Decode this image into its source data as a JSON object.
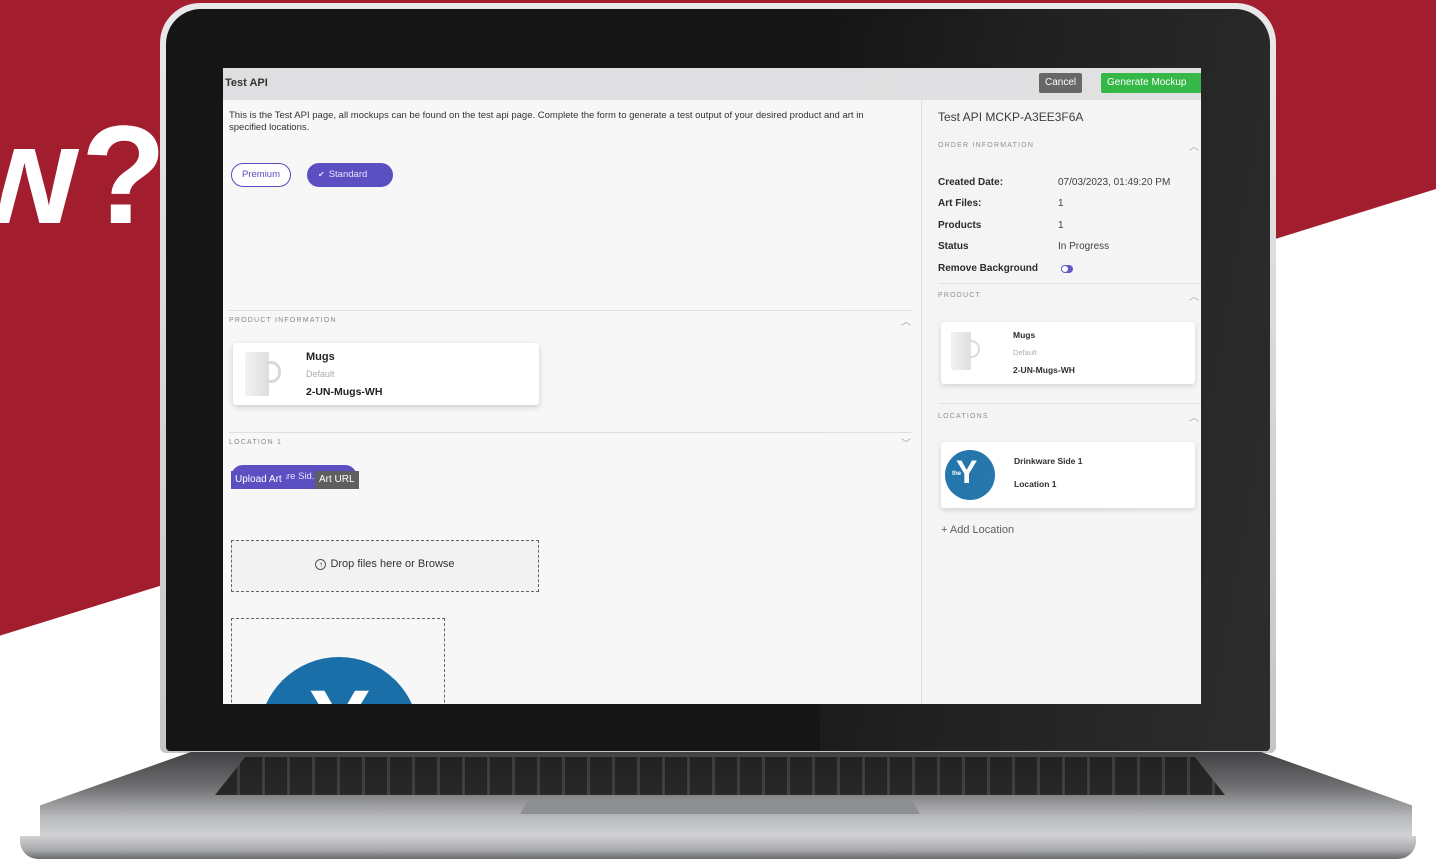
{
  "background": {
    "headline": "w?",
    "accent": "#a21d2e"
  },
  "window": {
    "title": "Test API",
    "cancel_label": "Cancel",
    "generate_label": "Generate Mockup"
  },
  "main": {
    "intro": "This is the Test API page, all mockups can be found on the test api page. Complete the form to generate a test output of your desired product and art in specified locations.",
    "tiers": {
      "premium": "Premium",
      "standard": "Standard"
    },
    "product_section": "PRODUCT INFORMATION",
    "product": {
      "name": "Mugs",
      "variant": "Default",
      "sku": "2-UN-Mugs-WH"
    },
    "location_section": "LOCATION 1",
    "location_chip": "Drinkware Sid...",
    "upload_label": "Upload Art",
    "art_url_label": "Art URL",
    "drop_text": "Drop files here or Browse",
    "art_logo_text": "the",
    "art_logo_letter": "Y"
  },
  "sidebar": {
    "title": "Test API MCKP-A3EE3F6A",
    "order_section": "ORDER INFORMATION",
    "info": {
      "created_label": "Created Date:",
      "created_value": "07/03/2023, 01:49:20 PM",
      "art_files_label": "Art Files:",
      "art_files_value": "1",
      "products_label": "Products",
      "products_value": "1",
      "status_label": "Status",
      "status_value": "In Progress",
      "remove_bg_label": "Remove Background",
      "remove_bg_on": true
    },
    "product_section": "PRODUCT",
    "product": {
      "name": "Mugs",
      "variant": "Default",
      "sku": "2-UN-Mugs-WH"
    },
    "locations_section": "LOCATIONS",
    "location": {
      "name": "Drinkware Side 1",
      "sub": "Location 1"
    },
    "add_location": "+ Add Location"
  },
  "colors": {
    "primary": "#5b4fc1",
    "success": "#26b33a",
    "logo_blue": "#1a6fa8"
  }
}
